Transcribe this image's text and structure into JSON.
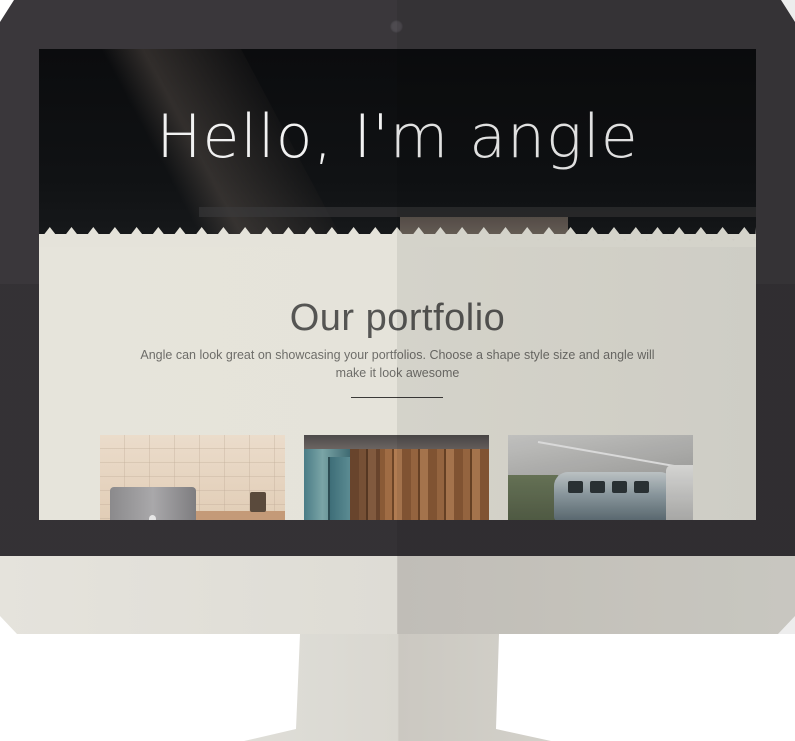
{
  "hero": {
    "title": "Hello, I'm angle"
  },
  "portfolio": {
    "title": "Our portfolio",
    "description": "Angle can look great on showcasing your portfolios. Choose a shape style size and angle will make it look awesome"
  },
  "thumbnails": [
    {
      "subject": "laptop on desk"
    },
    {
      "subject": "wooden shed doors"
    },
    {
      "subject": "vintage van in parking lot"
    }
  ],
  "colors": {
    "bezel": "#3a373b",
    "hero_bg": "#0b0c0e",
    "page_bg": "#e5e3da",
    "divider": "#3b3a38"
  }
}
